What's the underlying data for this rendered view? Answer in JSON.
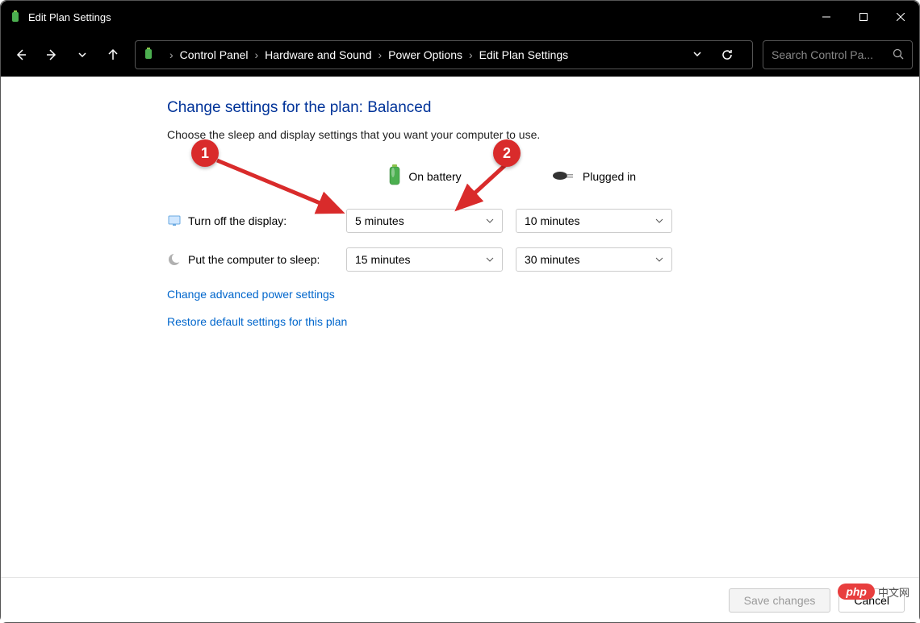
{
  "window": {
    "title": "Edit Plan Settings"
  },
  "breadcrumb": {
    "items": [
      "Control Panel",
      "Hardware and Sound",
      "Power Options",
      "Edit Plan Settings"
    ]
  },
  "search": {
    "placeholder": "Search Control Pa..."
  },
  "page": {
    "heading": "Change settings for the plan: Balanced",
    "subtext": "Choose the sleep and display settings that you want your computer to use.",
    "columns": {
      "battery": "On battery",
      "plugged": "Plugged in"
    },
    "rows": {
      "display": {
        "label": "Turn off the display:",
        "battery": "5 minutes",
        "plugged": "10 minutes"
      },
      "sleep": {
        "label": "Put the computer to sleep:",
        "battery": "15 minutes",
        "plugged": "30 minutes"
      }
    },
    "links": {
      "advanced": "Change advanced power settings",
      "restore": "Restore default settings for this plan"
    }
  },
  "footer": {
    "save": "Save changes",
    "cancel": "Cancel"
  },
  "annotations": {
    "c1": "1",
    "c2": "2"
  },
  "watermark": {
    "brand": "php",
    "text": "中文网"
  }
}
